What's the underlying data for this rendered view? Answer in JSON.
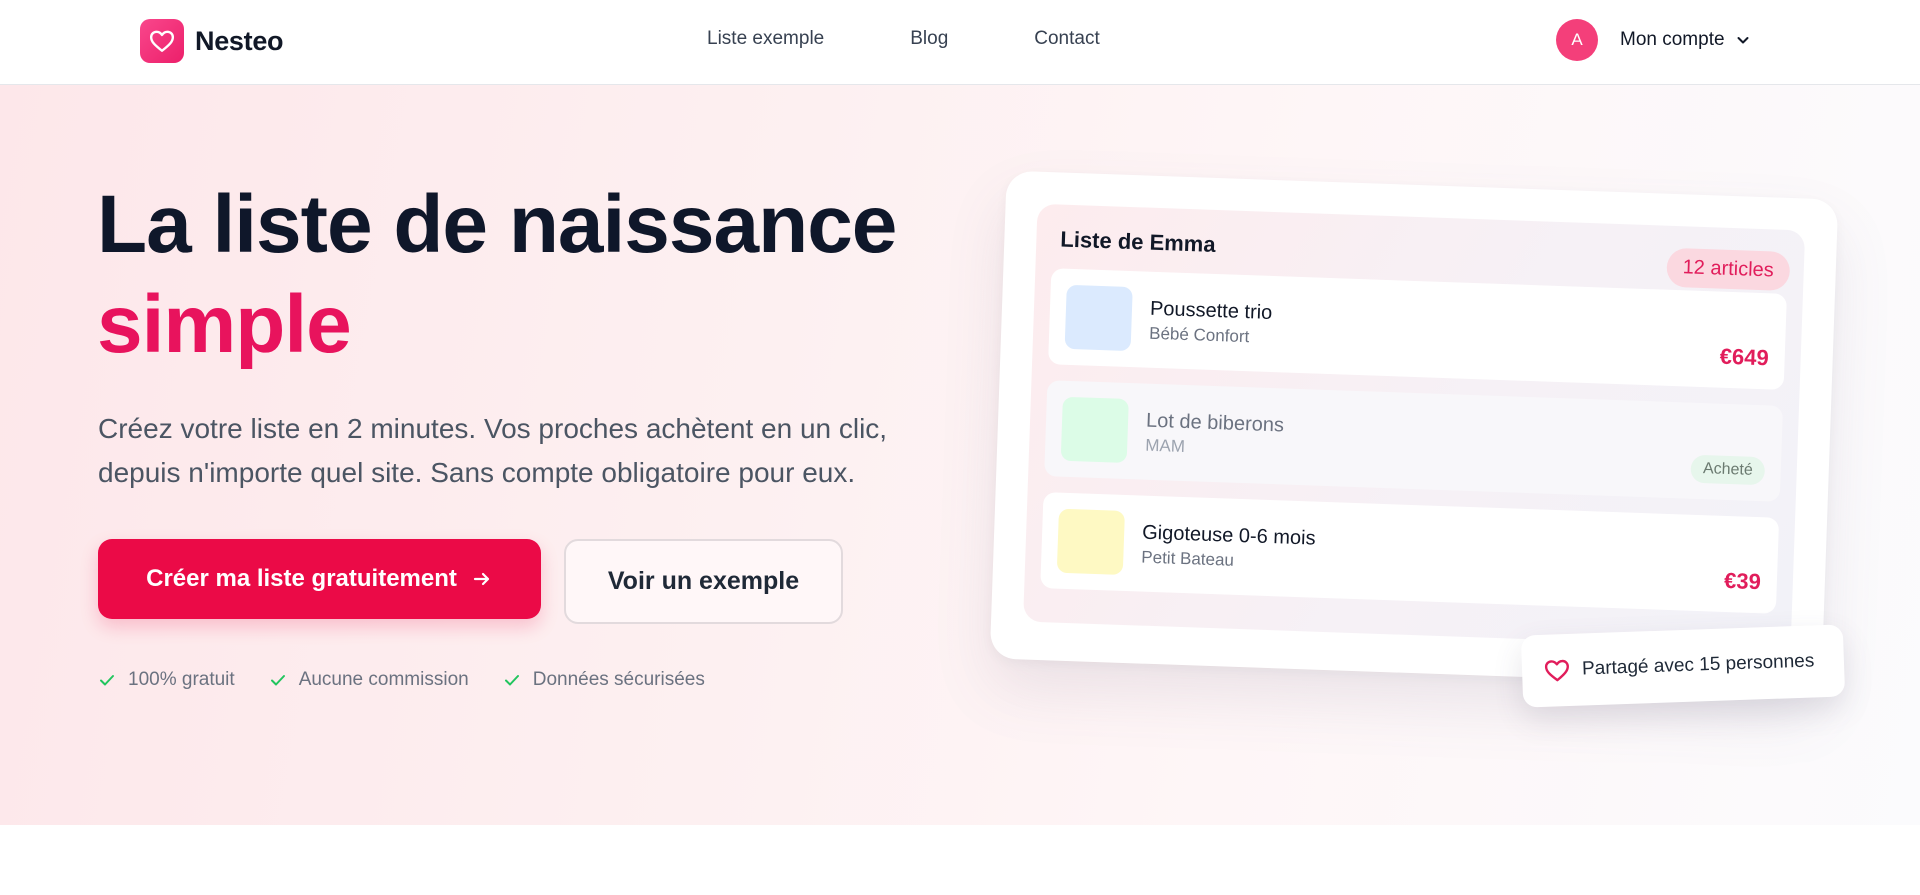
{
  "brand": {
    "name": "Nesteo",
    "color": "#ec1f6a"
  },
  "nav": {
    "items": [
      "Liste exemple",
      "Blog",
      "Contact"
    ]
  },
  "account": {
    "initial": "A",
    "label": "Mon compte"
  },
  "hero": {
    "title_line1": "La liste de naissance",
    "title_accent": "simple",
    "subtitle": "Créez votre liste en 2 minutes. Vos proches achètent en un clic, depuis n'importe quel site. Sans compte obligatoire pour eux.",
    "cta_primary": "Créer ma liste gratuitement",
    "cta_secondary": "Voir un exemple",
    "features": [
      "100% gratuit",
      "Aucune commission",
      "Données sécurisées"
    ]
  },
  "mockup": {
    "list_title": "Liste de Emma",
    "count_badge": "12 articles",
    "items": [
      {
        "name": "Poussette trio",
        "brand": "Bébé Confort",
        "price": "€649",
        "thumb_color": "#dbeafe"
      },
      {
        "name": "Lot de biberons",
        "brand": "MAM",
        "status": "Acheté",
        "thumb_color": "#dcfce7"
      },
      {
        "name": "Gigoteuse 0-6 mois",
        "brand": "Petit Bateau",
        "price": "€39",
        "thumb_color": "#fef9c3"
      }
    ],
    "share_text": "Partagé avec 15 personnes"
  }
}
